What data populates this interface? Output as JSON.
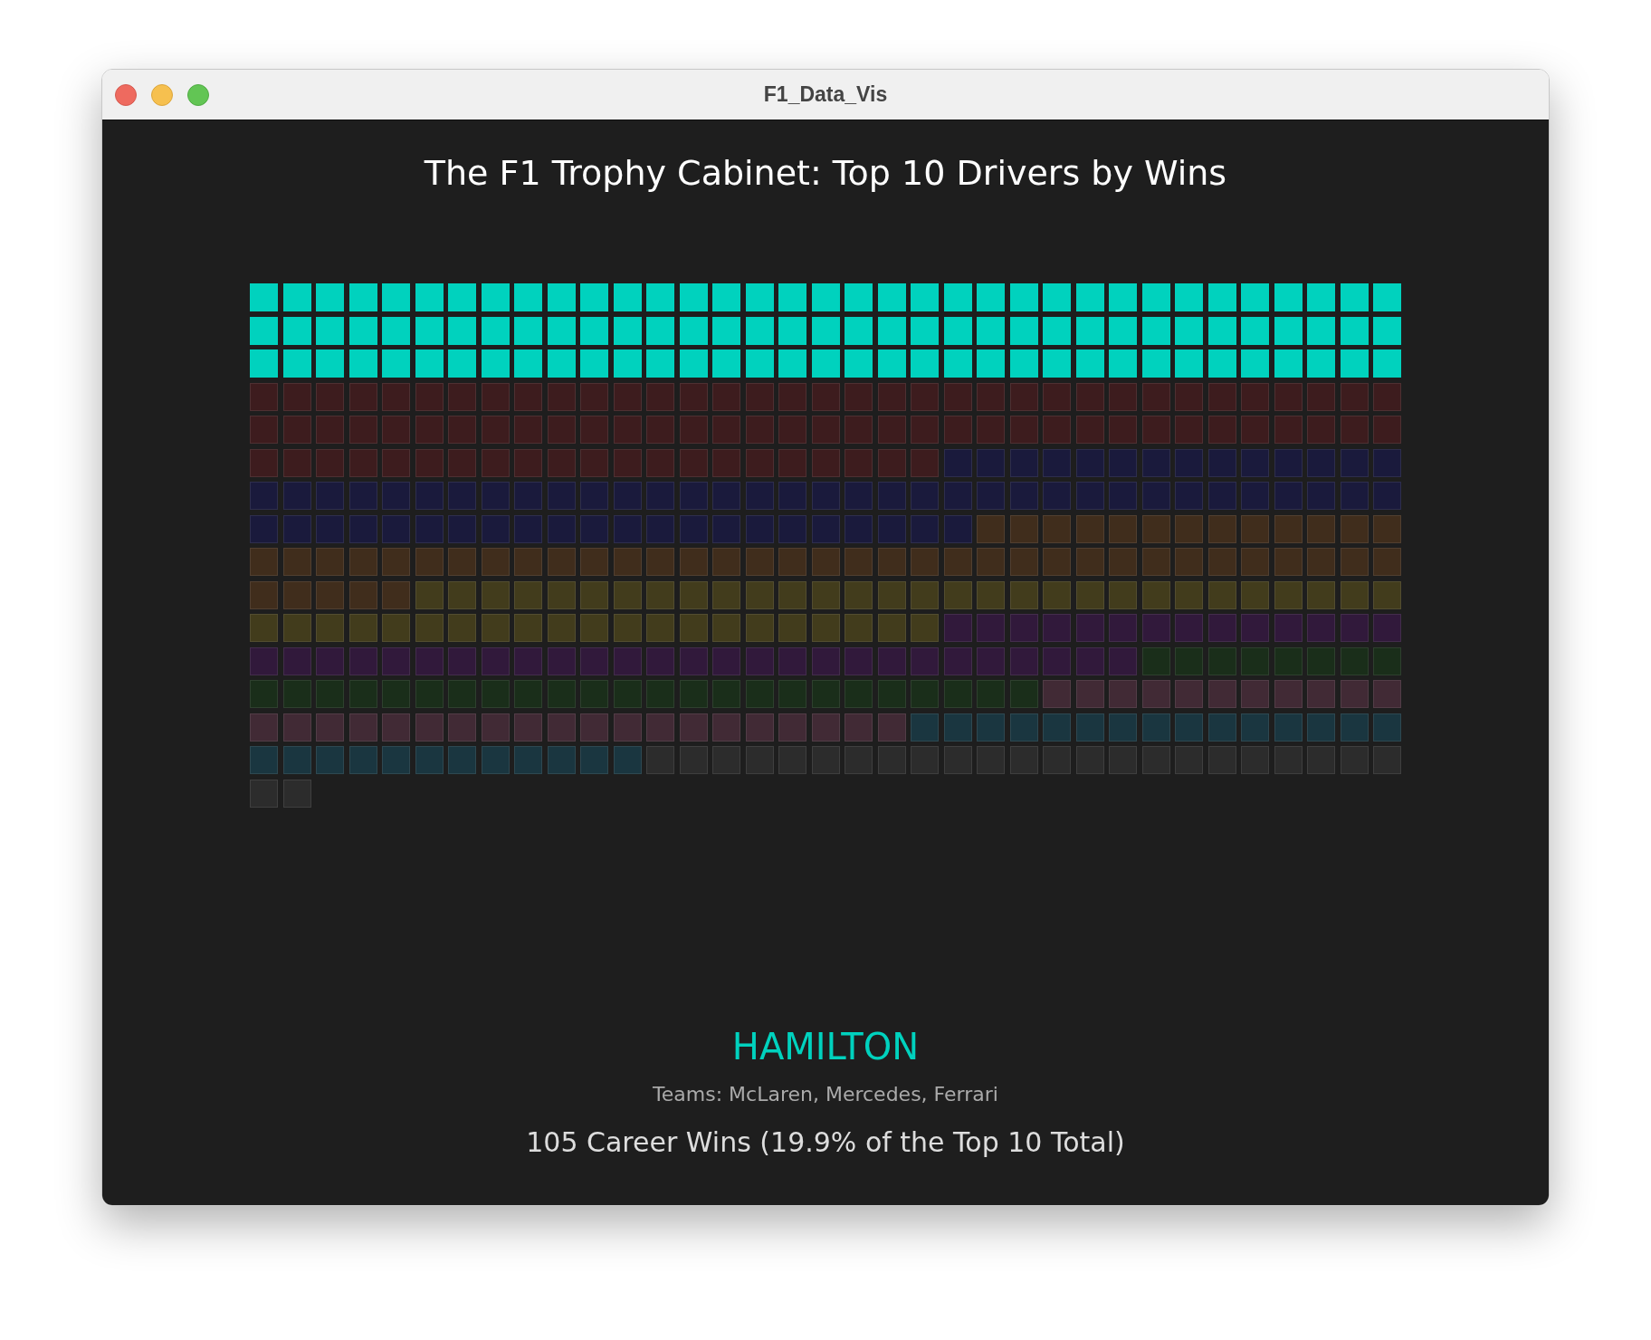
{
  "window": {
    "title": "F1_Data_Vis"
  },
  "chart_title": "The F1 Trophy Cabinet: Top 10 Drivers by Wins",
  "drivers": [
    {
      "color": "#00d2be",
      "selected": true
    },
    {
      "color": "#3d1c1e",
      "selected": false
    },
    {
      "color": "#1a1a3c",
      "selected": false
    },
    {
      "color": "#402d1c",
      "selected": false
    },
    {
      "color": "#423c1c",
      "selected": false
    },
    {
      "color": "#31193b",
      "selected": false
    },
    {
      "color": "#1a2e1a",
      "selected": false
    },
    {
      "color": "#412a35",
      "selected": false
    },
    {
      "color": "#1a3640",
      "selected": false
    },
    {
      "color": "#2c2c2c",
      "selected": false
    }
  ],
  "detail": {
    "name": "HAMILTON",
    "teams": "Teams: McLaren, Mercedes, Ferrari",
    "summary": "105 Career Wins (19.9% of the Top 10 Total)"
  }
}
